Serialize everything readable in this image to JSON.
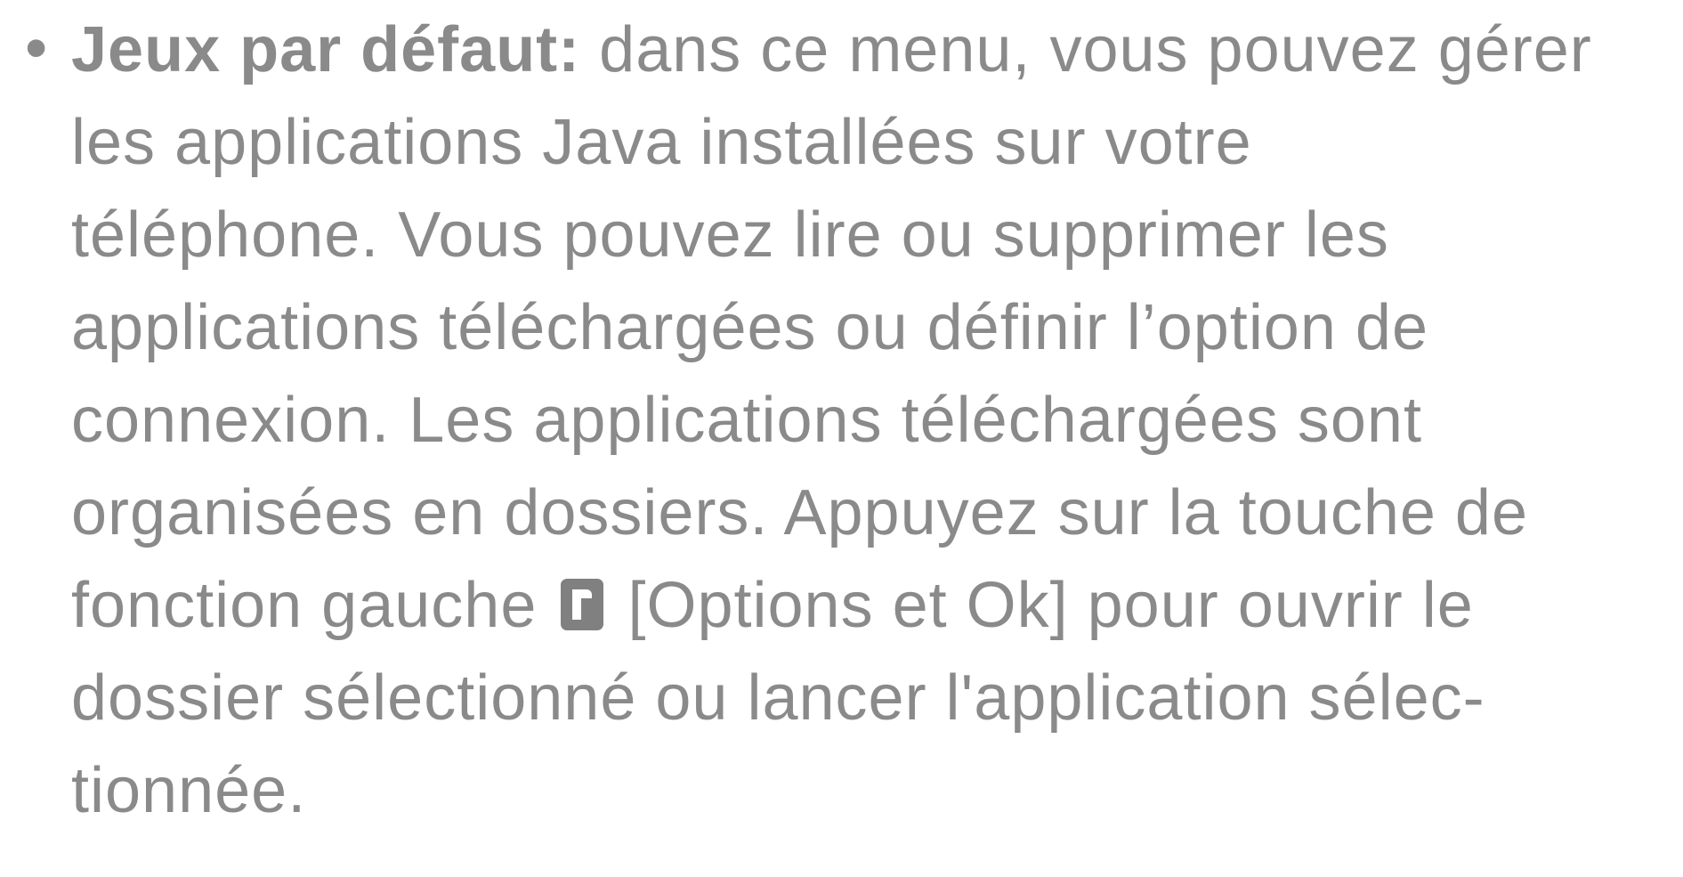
{
  "bullet": "•",
  "item": {
    "term": "Jeux par défaut:",
    "line1_rest": " dans ce menu, vous pouvez gérer",
    "line2": "les applications Java installées sur votre",
    "line3": "téléphone. Vous pouvez lire ou supprimer les",
    "line4": "applications téléchargées ou définir l’option de",
    "line5": "connexion. Les applications téléchargées sont",
    "line6": "organisées en dossiers. Appuyez sur la touche de",
    "line7_before_icon": "fonction gauche",
    "line7_after_icon": "[Options et Ok] pour ouvrir le",
    "line8": "dossier sélectionné ou lancer l'application sélec-",
    "line9": "tionnée.",
    "key_icon": "left-softkey-icon"
  }
}
